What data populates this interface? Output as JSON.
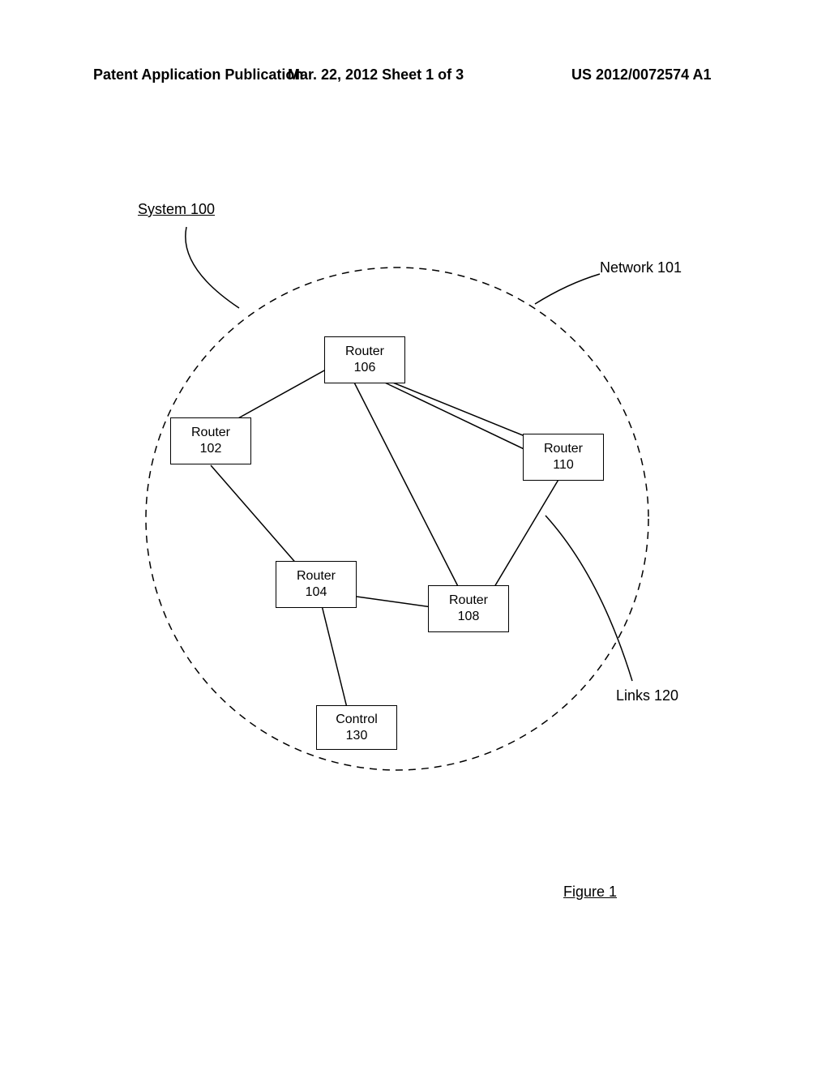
{
  "header": {
    "left": "Patent Application Publication",
    "mid": "Mar. 22, 2012  Sheet 1 of 3",
    "right": "US 2012/0072574 A1"
  },
  "system_label": "System 100",
  "network_label": "Network 101",
  "links_label": "Links 120",
  "figure_label": "Figure 1",
  "nodes": {
    "r102": {
      "name": "Router",
      "num": "102"
    },
    "r104": {
      "name": "Router",
      "num": "104"
    },
    "r106": {
      "name": "Router",
      "num": "106"
    },
    "r108": {
      "name": "Router",
      "num": "108"
    },
    "r110": {
      "name": "Router",
      "num": "110"
    },
    "control": {
      "name": "Control",
      "num": "130"
    }
  }
}
